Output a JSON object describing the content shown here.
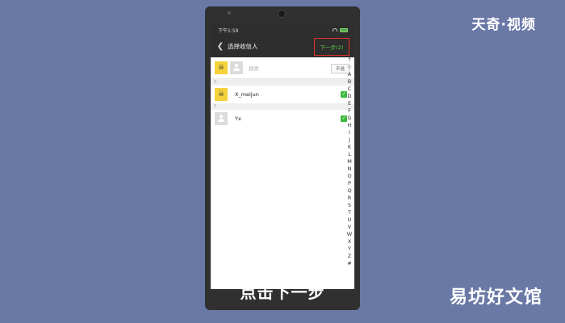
{
  "watermark_top": "天奇·视频",
  "watermark_bottom": "易坊好文馆",
  "caption": "点击下一步",
  "status": {
    "time": "下午1:59"
  },
  "topbar": {
    "back_icon": "chevron-left-icon",
    "title": "选择收信人",
    "next_label": "下一步(2)"
  },
  "search": {
    "placeholder": "搜索",
    "cancel_label": "不选"
  },
  "groups": [
    {
      "header": "X",
      "contact": {
        "name": "X_meijun",
        "avatar": "yellow",
        "checked": true
      }
    },
    {
      "header": "Y",
      "contact": {
        "name": "Yx",
        "avatar": "grey",
        "checked": true
      }
    }
  ],
  "index_letters": [
    "↑",
    "☆",
    "A",
    "B",
    "C",
    "D",
    "E",
    "F",
    "G",
    "H",
    "I",
    "J",
    "K",
    "L",
    "M",
    "N",
    "O",
    "P",
    "Q",
    "R",
    "S",
    "T",
    "U",
    "V",
    "W",
    "X",
    "Y",
    "Z",
    "#"
  ],
  "colors": {
    "background": "#6a78a6",
    "accent_green": "#5dc84a",
    "highlight_red": "#e03030",
    "avatar_yellow": "#f6d23a"
  }
}
